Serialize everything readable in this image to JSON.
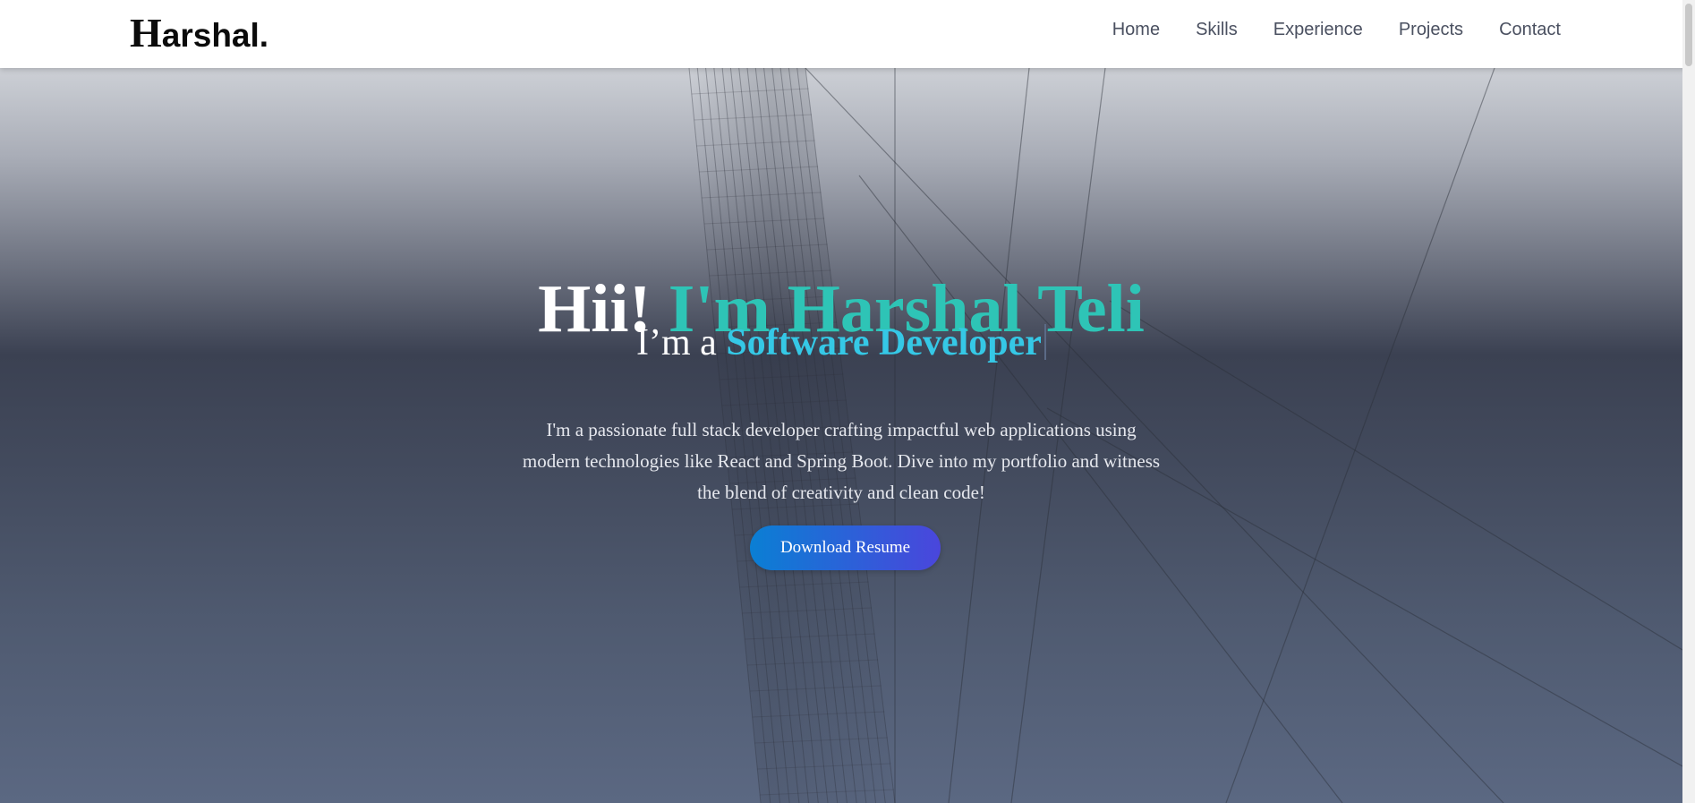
{
  "navbar": {
    "logo_initial": "H",
    "logo_rest": "arshal.",
    "links": [
      {
        "label": "Home"
      },
      {
        "label": "Skills"
      },
      {
        "label": "Experience"
      },
      {
        "label": "Projects"
      },
      {
        "label": "Contact"
      }
    ]
  },
  "hero": {
    "greeting": "Hii!",
    "name": "I'm Harshal Teli",
    "role_prefix": "I’m a",
    "role": "Software Developer",
    "description": "I'm a passionate full stack developer crafting impactful web applications using modern technologies like React and Spring Boot. Dive into my portfolio and witness the blend of creativity and clean code!",
    "resume_button": "Download Resume"
  },
  "colors": {
    "name_accent": "#2ec4b6",
    "role_accent": "#35c8e6",
    "button_gradient_start": "#0a7fd4",
    "button_gradient_end": "#4a46dc",
    "nav_text": "#4a5060"
  }
}
